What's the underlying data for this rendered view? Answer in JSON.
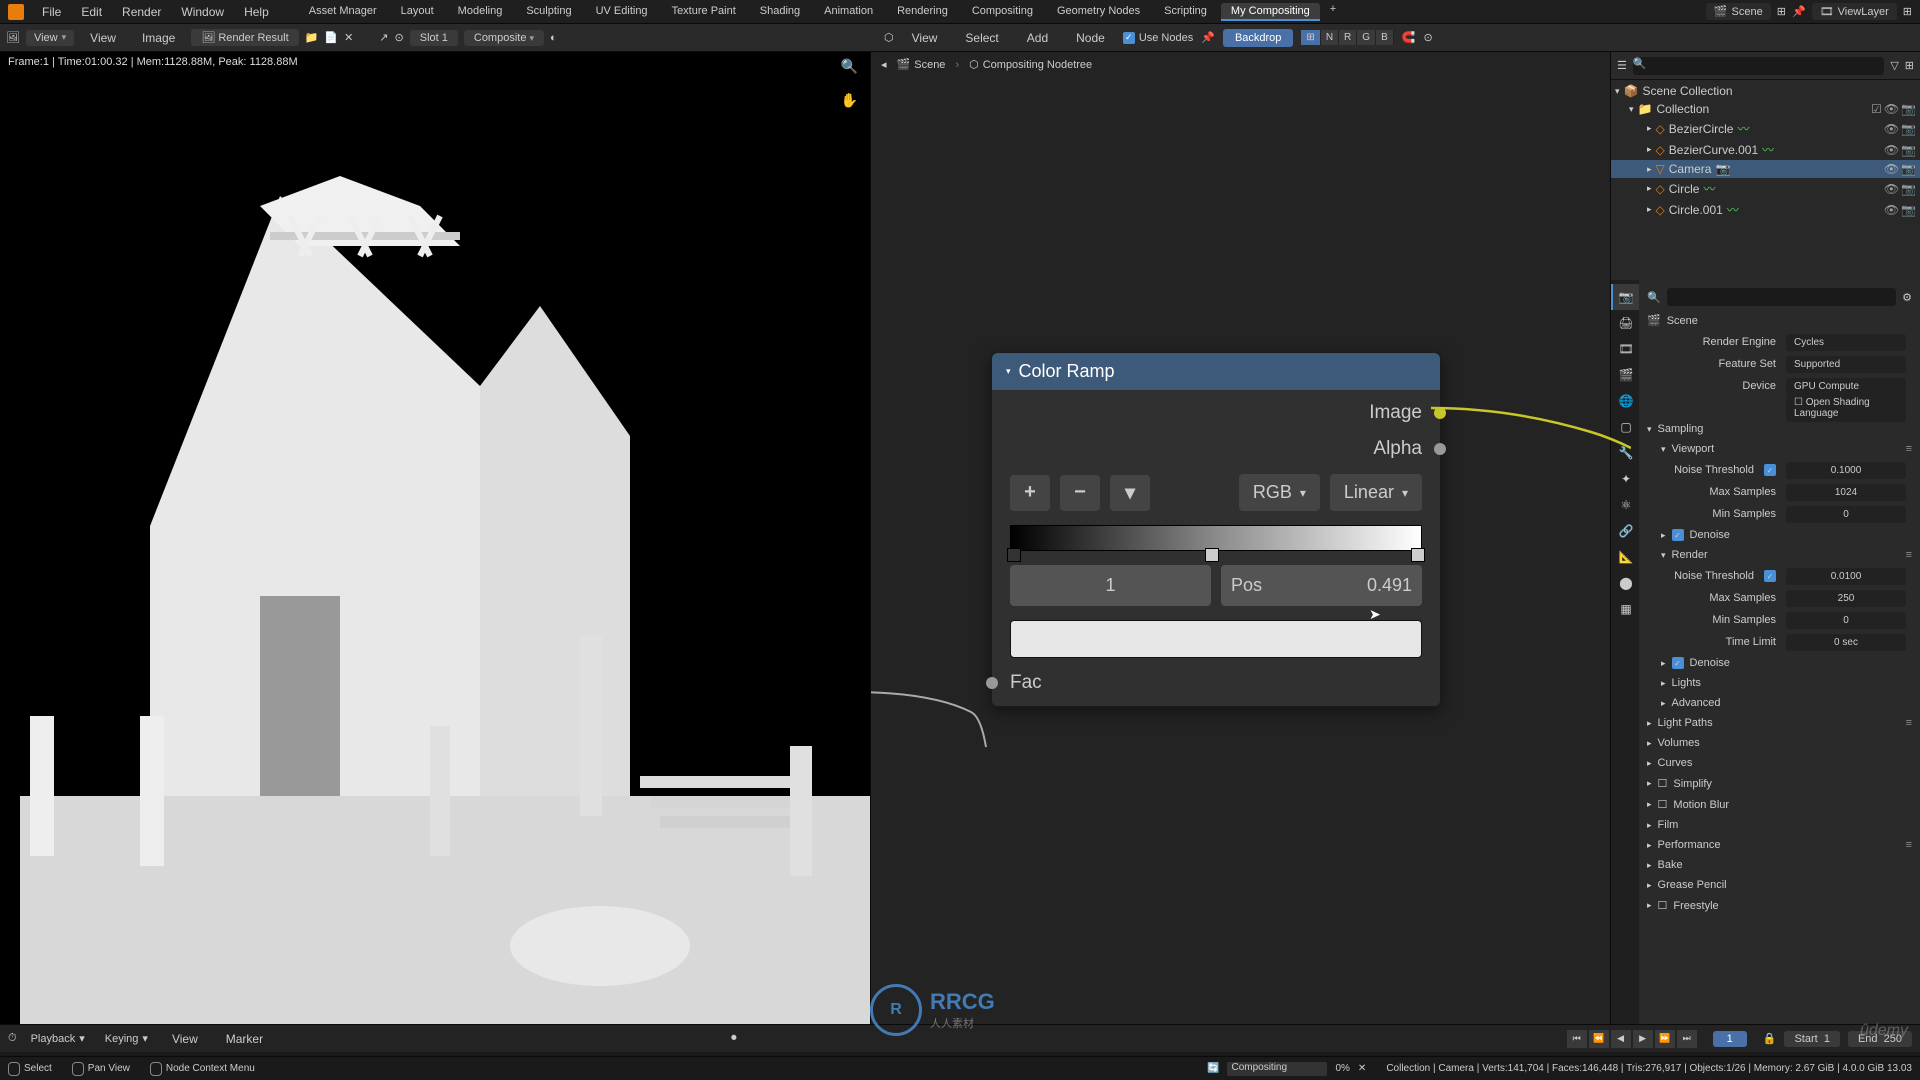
{
  "topbar": {
    "menus": [
      "File",
      "Edit",
      "Render",
      "Window",
      "Help"
    ],
    "workspaces": [
      "Asset Mnager",
      "Layout",
      "Modeling",
      "Sculpting",
      "UV Editing",
      "Texture Paint",
      "Shading",
      "Animation",
      "Rendering",
      "Compositing",
      "Geometry Nodes",
      "Scripting",
      "My Compositing"
    ],
    "active_ws": 12,
    "scene": "Scene",
    "viewlayer": "ViewLayer"
  },
  "image_header": {
    "view": "View",
    "view2": "View",
    "image": "Image",
    "render_result": "Render Result",
    "slot": "Slot 1",
    "composite": "Composite",
    "stats": "Frame:1 | Time:01:00.32 | Mem:1128.88M, Peak: 1128.88M"
  },
  "node_header": {
    "view": "View",
    "select": "Select",
    "add": "Add",
    "node": "Node",
    "use_nodes_label": "Use Nodes",
    "backdrop": "Backdrop",
    "channels": [
      "N",
      "R",
      "G",
      "B"
    ]
  },
  "breadcrumb": {
    "scene": "Scene",
    "tree": "Compositing Nodetree"
  },
  "node_color_ramp": {
    "title": "Color Ramp",
    "out_image": "Image",
    "out_alpha": "Alpha",
    "mode": "RGB",
    "interp": "Linear",
    "index": "1",
    "pos_label": "Pos",
    "pos_value": "0.491",
    "fac": "Fac"
  },
  "outliner": {
    "root": "Scene Collection",
    "collection": "Collection",
    "items": [
      {
        "name": "BezierCircle",
        "type": "curve"
      },
      {
        "name": "BezierCurve.001",
        "type": "curve"
      },
      {
        "name": "Camera",
        "type": "camera",
        "selected": true
      },
      {
        "name": "Circle",
        "type": "curve"
      },
      {
        "name": "Circle.001",
        "type": "curve"
      }
    ]
  },
  "properties": {
    "scene_name": "Scene",
    "render_engine_label": "Render Engine",
    "render_engine": "Cycles",
    "feature_set_label": "Feature Set",
    "feature_set": "Supported",
    "device_label": "Device",
    "device": "GPU Compute",
    "osl": "Open Shading Language",
    "sections": {
      "sampling": "Sampling",
      "viewport": "Viewport",
      "render": "Render",
      "denoise": "Denoise",
      "lights": "Lights",
      "advanced": "Advanced",
      "light_paths": "Light Paths",
      "volumes": "Volumes",
      "curves": "Curves",
      "simplify": "Simplify",
      "motion_blur": "Motion Blur",
      "film": "Film",
      "performance": "Performance",
      "bake": "Bake",
      "grease": "Grease Pencil",
      "freestyle": "Freestyle"
    },
    "viewport_vals": {
      "noise_label": "Noise Threshold",
      "noise": "0.1000",
      "max_label": "Max Samples",
      "max": "1024",
      "min_label": "Min Samples",
      "min": "0"
    },
    "render_vals": {
      "noise_label": "Noise Threshold",
      "noise": "0.0100",
      "max_label": "Max Samples",
      "max": "250",
      "min_label": "Min Samples",
      "min": "0",
      "time_label": "Time Limit",
      "time": "0 sec"
    }
  },
  "timeline": {
    "playback": "Playback",
    "keying": "Keying",
    "view": "View",
    "marker": "Marker",
    "current": "1",
    "start_label": "Start",
    "start": "1",
    "end_label": "End",
    "end": "250"
  },
  "status": {
    "select": "Select",
    "pan": "Pan View",
    "context": "Node Context Menu",
    "compositing": "Compositing",
    "percent": "0%",
    "stats": "Collection | Camera | Verts:141,704 | Faces:146,448 | Tris:276,917 | Objects:1/26 | Memory: 2.67 GiB | 4.0.0 GiB 13.03"
  },
  "watermark": {
    "logo": "R",
    "text": "RRCG",
    "sub": "人人素材"
  }
}
